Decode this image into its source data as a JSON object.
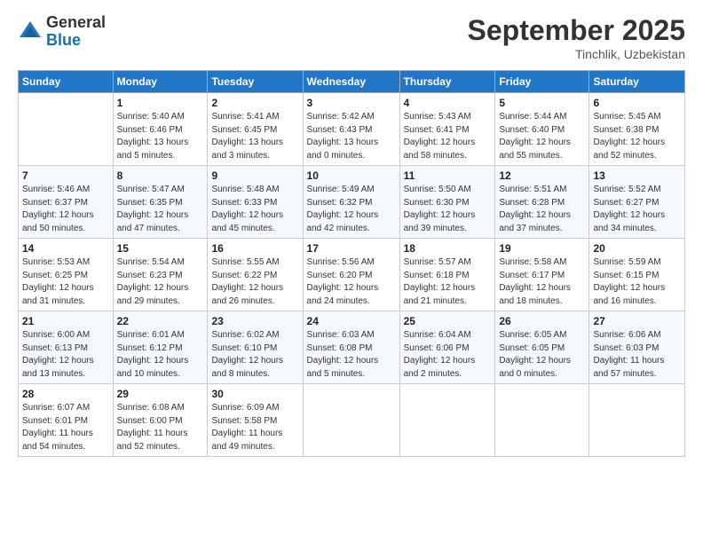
{
  "logo": {
    "general": "General",
    "blue": "Blue"
  },
  "header": {
    "month": "September 2025",
    "location": "Tinchlik, Uzbekistan"
  },
  "weekdays": [
    "Sunday",
    "Monday",
    "Tuesday",
    "Wednesday",
    "Thursday",
    "Friday",
    "Saturday"
  ],
  "weeks": [
    [
      {
        "day": "",
        "sunrise": "",
        "sunset": "",
        "daylight": ""
      },
      {
        "day": "1",
        "sunrise": "Sunrise: 5:40 AM",
        "sunset": "Sunset: 6:46 PM",
        "daylight": "Daylight: 13 hours and 5 minutes."
      },
      {
        "day": "2",
        "sunrise": "Sunrise: 5:41 AM",
        "sunset": "Sunset: 6:45 PM",
        "daylight": "Daylight: 13 hours and 3 minutes."
      },
      {
        "day": "3",
        "sunrise": "Sunrise: 5:42 AM",
        "sunset": "Sunset: 6:43 PM",
        "daylight": "Daylight: 13 hours and 0 minutes."
      },
      {
        "day": "4",
        "sunrise": "Sunrise: 5:43 AM",
        "sunset": "Sunset: 6:41 PM",
        "daylight": "Daylight: 12 hours and 58 minutes."
      },
      {
        "day": "5",
        "sunrise": "Sunrise: 5:44 AM",
        "sunset": "Sunset: 6:40 PM",
        "daylight": "Daylight: 12 hours and 55 minutes."
      },
      {
        "day": "6",
        "sunrise": "Sunrise: 5:45 AM",
        "sunset": "Sunset: 6:38 PM",
        "daylight": "Daylight: 12 hours and 52 minutes."
      }
    ],
    [
      {
        "day": "7",
        "sunrise": "Sunrise: 5:46 AM",
        "sunset": "Sunset: 6:37 PM",
        "daylight": "Daylight: 12 hours and 50 minutes."
      },
      {
        "day": "8",
        "sunrise": "Sunrise: 5:47 AM",
        "sunset": "Sunset: 6:35 PM",
        "daylight": "Daylight: 12 hours and 47 minutes."
      },
      {
        "day": "9",
        "sunrise": "Sunrise: 5:48 AM",
        "sunset": "Sunset: 6:33 PM",
        "daylight": "Daylight: 12 hours and 45 minutes."
      },
      {
        "day": "10",
        "sunrise": "Sunrise: 5:49 AM",
        "sunset": "Sunset: 6:32 PM",
        "daylight": "Daylight: 12 hours and 42 minutes."
      },
      {
        "day": "11",
        "sunrise": "Sunrise: 5:50 AM",
        "sunset": "Sunset: 6:30 PM",
        "daylight": "Daylight: 12 hours and 39 minutes."
      },
      {
        "day": "12",
        "sunrise": "Sunrise: 5:51 AM",
        "sunset": "Sunset: 6:28 PM",
        "daylight": "Daylight: 12 hours and 37 minutes."
      },
      {
        "day": "13",
        "sunrise": "Sunrise: 5:52 AM",
        "sunset": "Sunset: 6:27 PM",
        "daylight": "Daylight: 12 hours and 34 minutes."
      }
    ],
    [
      {
        "day": "14",
        "sunrise": "Sunrise: 5:53 AM",
        "sunset": "Sunset: 6:25 PM",
        "daylight": "Daylight: 12 hours and 31 minutes."
      },
      {
        "day": "15",
        "sunrise": "Sunrise: 5:54 AM",
        "sunset": "Sunset: 6:23 PM",
        "daylight": "Daylight: 12 hours and 29 minutes."
      },
      {
        "day": "16",
        "sunrise": "Sunrise: 5:55 AM",
        "sunset": "Sunset: 6:22 PM",
        "daylight": "Daylight: 12 hours and 26 minutes."
      },
      {
        "day": "17",
        "sunrise": "Sunrise: 5:56 AM",
        "sunset": "Sunset: 6:20 PM",
        "daylight": "Daylight: 12 hours and 24 minutes."
      },
      {
        "day": "18",
        "sunrise": "Sunrise: 5:57 AM",
        "sunset": "Sunset: 6:18 PM",
        "daylight": "Daylight: 12 hours and 21 minutes."
      },
      {
        "day": "19",
        "sunrise": "Sunrise: 5:58 AM",
        "sunset": "Sunset: 6:17 PM",
        "daylight": "Daylight: 12 hours and 18 minutes."
      },
      {
        "day": "20",
        "sunrise": "Sunrise: 5:59 AM",
        "sunset": "Sunset: 6:15 PM",
        "daylight": "Daylight: 12 hours and 16 minutes."
      }
    ],
    [
      {
        "day": "21",
        "sunrise": "Sunrise: 6:00 AM",
        "sunset": "Sunset: 6:13 PM",
        "daylight": "Daylight: 12 hours and 13 minutes."
      },
      {
        "day": "22",
        "sunrise": "Sunrise: 6:01 AM",
        "sunset": "Sunset: 6:12 PM",
        "daylight": "Daylight: 12 hours and 10 minutes."
      },
      {
        "day": "23",
        "sunrise": "Sunrise: 6:02 AM",
        "sunset": "Sunset: 6:10 PM",
        "daylight": "Daylight: 12 hours and 8 minutes."
      },
      {
        "day": "24",
        "sunrise": "Sunrise: 6:03 AM",
        "sunset": "Sunset: 6:08 PM",
        "daylight": "Daylight: 12 hours and 5 minutes."
      },
      {
        "day": "25",
        "sunrise": "Sunrise: 6:04 AM",
        "sunset": "Sunset: 6:06 PM",
        "daylight": "Daylight: 12 hours and 2 minutes."
      },
      {
        "day": "26",
        "sunrise": "Sunrise: 6:05 AM",
        "sunset": "Sunset: 6:05 PM",
        "daylight": "Daylight: 12 hours and 0 minutes."
      },
      {
        "day": "27",
        "sunrise": "Sunrise: 6:06 AM",
        "sunset": "Sunset: 6:03 PM",
        "daylight": "Daylight: 11 hours and 57 minutes."
      }
    ],
    [
      {
        "day": "28",
        "sunrise": "Sunrise: 6:07 AM",
        "sunset": "Sunset: 6:01 PM",
        "daylight": "Daylight: 11 hours and 54 minutes."
      },
      {
        "day": "29",
        "sunrise": "Sunrise: 6:08 AM",
        "sunset": "Sunset: 6:00 PM",
        "daylight": "Daylight: 11 hours and 52 minutes."
      },
      {
        "day": "30",
        "sunrise": "Sunrise: 6:09 AM",
        "sunset": "Sunset: 5:58 PM",
        "daylight": "Daylight: 11 hours and 49 minutes."
      },
      {
        "day": "",
        "sunrise": "",
        "sunset": "",
        "daylight": ""
      },
      {
        "day": "",
        "sunrise": "",
        "sunset": "",
        "daylight": ""
      },
      {
        "day": "",
        "sunrise": "",
        "sunset": "",
        "daylight": ""
      },
      {
        "day": "",
        "sunrise": "",
        "sunset": "",
        "daylight": ""
      }
    ]
  ]
}
